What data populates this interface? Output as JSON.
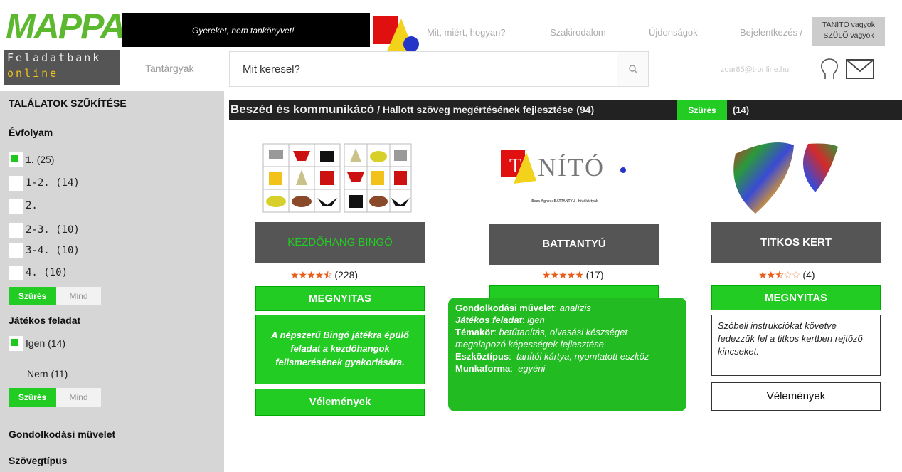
{
  "header": {
    "logo": "MAPPA",
    "brand_line1": "Feladatbank",
    "brand_line2": "online",
    "slogan": "Gyereket, nem tankönyvet!",
    "nav": [
      "Mit, miért, hogyan?",
      "Szakirodalom",
      "Újdonságok",
      "Bejelentkezés /"
    ],
    "role_line1": "TANÍTÓ vagyok",
    "role_line2": "SZÜLŐ vagyok",
    "subjects_label": "Tantárgyak",
    "search_placeholder": "Mit keresel?",
    "user_email": "zoar85@t-online.hu"
  },
  "sidebar": {
    "title": "TALÁLATOK SZŰKÍTÉSE",
    "grade_heading": "Évfolyam",
    "grades": [
      {
        "label": "1. (25)",
        "checked": true
      },
      {
        "label": "1-2. (14)",
        "checked": false
      },
      {
        "label": "2.",
        "checked": false
      },
      {
        "label": "2-3. (10)",
        "checked": false
      },
      {
        "label": "3-4. (10)",
        "checked": false
      },
      {
        "label": "4. (10)",
        "checked": false
      }
    ],
    "filter_label": "Szűrés",
    "all_label": "Mind",
    "game_heading": "Játékos feladat",
    "game_yes": "Igen (14)",
    "game_no": "Nem (11)",
    "thinking_heading": "Gondolkodási művelet",
    "texttype_heading": "Szövegtípus"
  },
  "breadcrumb": {
    "category": "Beszéd és kommunikácó",
    "separator": " / ",
    "subcategory": "Hallott szöveg megértésének fejlesztése",
    "count": "(94)",
    "filter_label": "Szűrés",
    "filtered_count": "(14)"
  },
  "cards": [
    {
      "title": "KEZDŐHANG BINGÓ",
      "rating": 4.5,
      "stars": "★★★★",
      "stars_half": "⯪",
      "reviews": "(228)",
      "open_label": "MEGNYITAS",
      "description": "A népszerű Bingó játékra épülő feladat a kezdőhangok felismerésének gyakorlására.",
      "reviews_label": "Vélemények"
    },
    {
      "title": "BATTANTYÚ",
      "rating": 5,
      "stars": "★★★★★",
      "reviews": "(17)",
      "thumb_logo": "NÍTÓ",
      "thumb_caption": "Baza Ágnes: BATTANTYÚ - hívókártyák"
    },
    {
      "title": "TITKOS KERT",
      "rating": 2.5,
      "stars": "★★",
      "stars_half": "⯪",
      "stars_off": "☆☆",
      "reviews": "(4)",
      "open_label": "MEGNYITAS",
      "description": "Szóbeli instrukciókat követve fedezzük fel a titkos kertben rejtőző kincseket.",
      "reviews_label": "Vélemények"
    }
  ],
  "tooltip": {
    "l1_key": "Gondolkodási művelet",
    "l1_val": "analízis",
    "l2_key": "Játékos feladat",
    "l2_val": "igen",
    "l3_key": "Témakör",
    "l3_val": "betűtanítás, olvasási készséget megalapozó képességek fejlesztése",
    "l4_key": "Eszköztípus",
    "l4_val": "tanítói kártya, nyomtatott eszköz",
    "l5_key": "Munkaforma",
    "l5_val": "egyéni"
  },
  "colors": {
    "accent_green": "#22cc22",
    "header_dark": "#222222",
    "title_gray": "#555555",
    "star_orange": "#e85d1a"
  }
}
